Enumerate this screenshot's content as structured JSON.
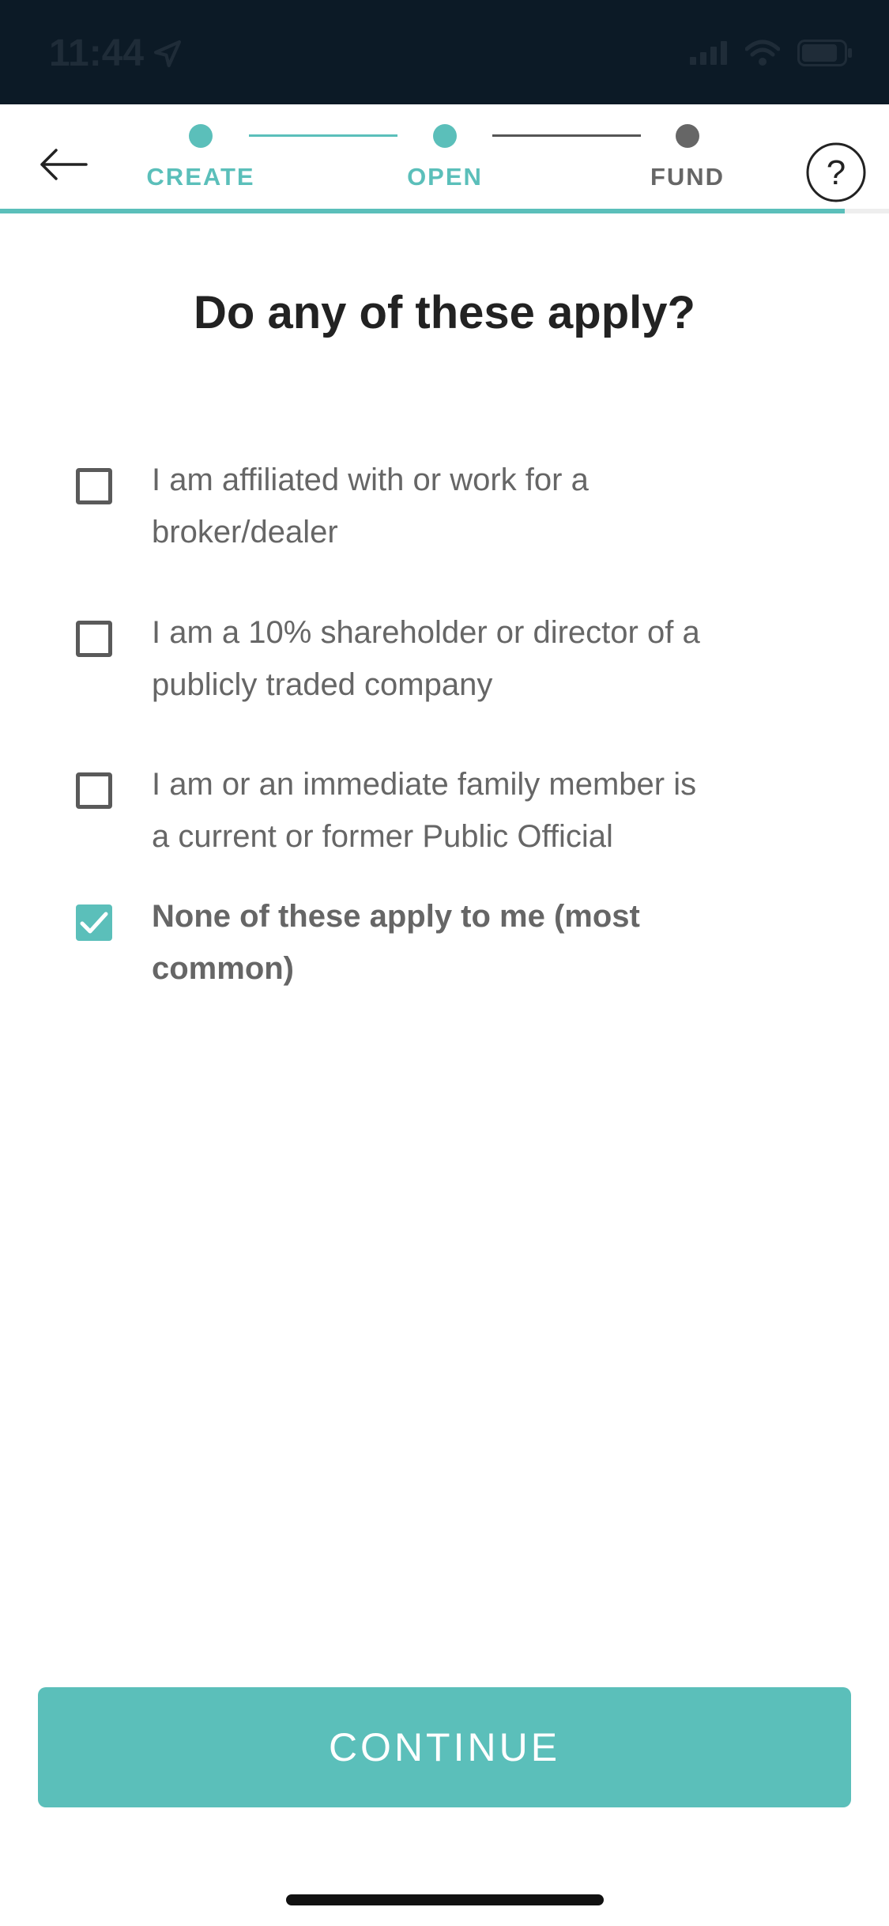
{
  "status_bar": {
    "time": "11:44"
  },
  "nav": {
    "steps": [
      {
        "label": "CREATE",
        "state": "done"
      },
      {
        "label": "OPEN",
        "state": "active"
      },
      {
        "label": "FUND",
        "state": "pending"
      }
    ],
    "help_symbol": "?"
  },
  "colors": {
    "accent": "#5bbfba",
    "pending": "#666666",
    "status_bar": "#0c1a26"
  },
  "page": {
    "title": "Do any of these apply?"
  },
  "options": [
    {
      "label": "I am affiliated with or work for a broker/dealer",
      "checked": false
    },
    {
      "label": "I am a 10% shareholder or director of a publicly traded company",
      "checked": false
    },
    {
      "label": "I am or an immediate family member is a current or former Public Official",
      "checked": false
    },
    {
      "label": "None of these apply to me (most common)",
      "checked": true
    }
  ],
  "footer": {
    "continue_label": "CONTINUE"
  },
  "progress": {
    "fraction": 0.95
  }
}
